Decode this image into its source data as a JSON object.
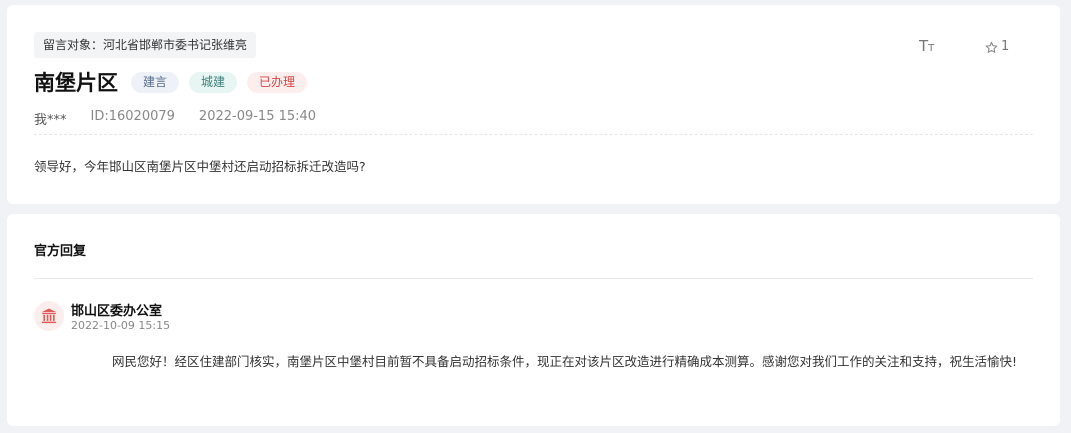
{
  "message": {
    "recipient": "留言对象：河北省邯郸市委书记张维亮",
    "font_size_icon": "font-size-icon",
    "font_size_big": "T",
    "font_size_small": "T",
    "favorite_count": "1",
    "title": "南堡片区",
    "tags": [
      "建言",
      "城建",
      "已办理"
    ],
    "author": "我***",
    "id": "ID:16020079",
    "time": "2022-09-15 15:40",
    "content": "领导好，今年邯山区南堡片区中堡村还启动招标拆迁改造吗?"
  },
  "reply": {
    "section_title": "官方回复",
    "org_icon": "government-building-icon",
    "org_name": "邯山区委办公室",
    "time": "2022-10-09 15:15",
    "content": "网民您好！经区住建部门核实，南堡片区中堡村目前暂不具备启动招标条件，现正在对该片区改造进行精确成本测算。感谢您对我们工作的关注和支持，祝生活愉快!"
  },
  "colors": {
    "tag_suggest": "#566b8c",
    "tag_construction": "#3e7f7a",
    "tag_done": "#d64545",
    "accent_red": "#e05a5a"
  }
}
